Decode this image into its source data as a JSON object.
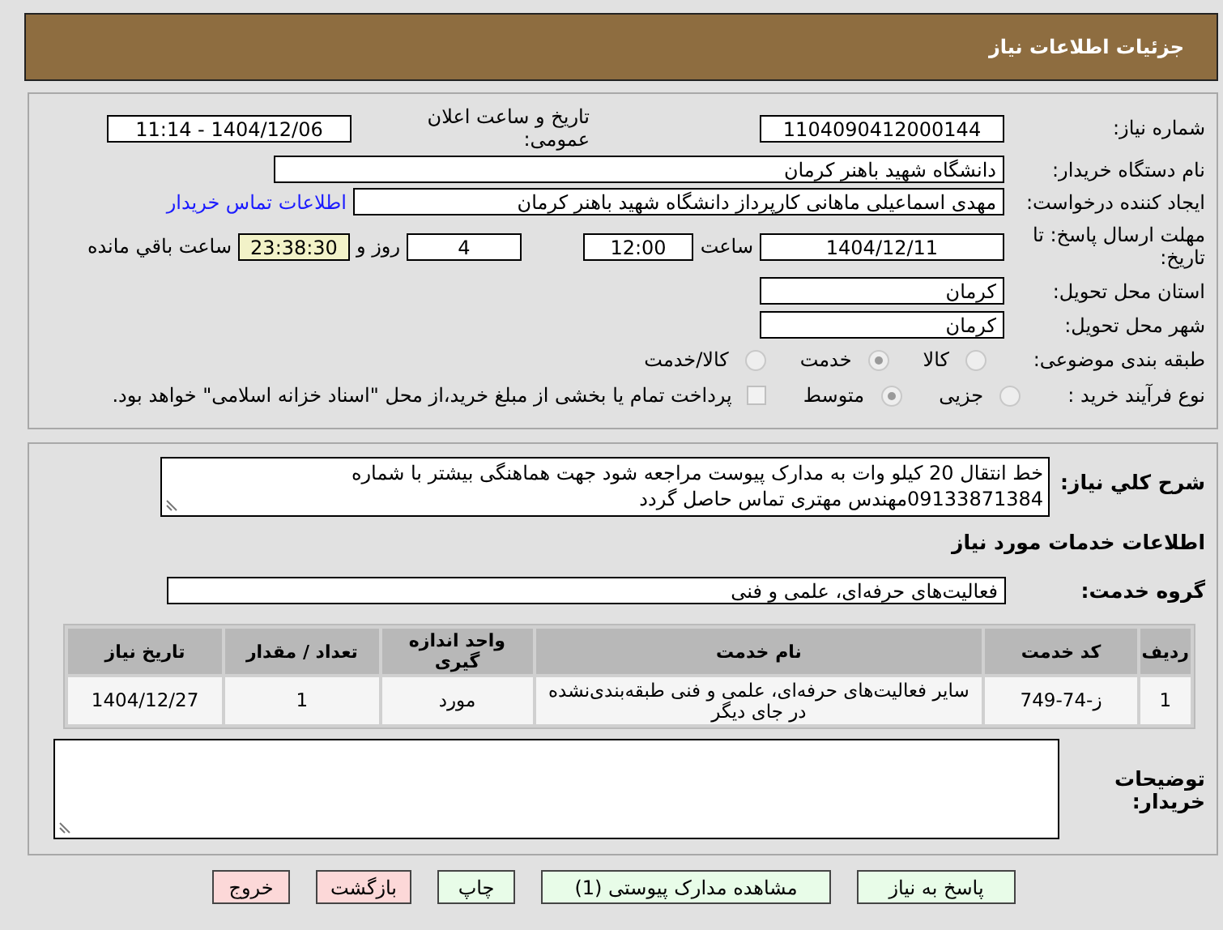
{
  "header": {
    "title": "جزئیات اطلاعات نیاز"
  },
  "need_number": {
    "label": "شماره نیاز:",
    "value": "1104090412000144"
  },
  "announce": {
    "label": "تاریخ و ساعت اعلان عمومی:",
    "value": "1404/12/06 - 11:14"
  },
  "buyer": {
    "label": "نام دستگاه خریدار:",
    "value": "دانشگاه شهید باهنر کرمان"
  },
  "creator": {
    "label": "ایجاد کننده درخواست:",
    "value": "مهدی اسماعیلی ماهانی  کارپرداز دانشگاه شهید باهنر کرمان",
    "link": "اطلاعات تماس خریدار"
  },
  "deadline": {
    "label": "مهلت ارسال پاسخ: تا تاریخ:",
    "date": "1404/12/11",
    "time_label": "ساعت",
    "time": "12:00",
    "days": "4",
    "days_label": "روز و",
    "remaining": "23:38:30",
    "remaining_label": "ساعت باقي مانده"
  },
  "province": {
    "label": "استان محل تحویل:",
    "value": "کرمان"
  },
  "city": {
    "label": "شهر محل تحویل:",
    "value": "کرمان"
  },
  "category": {
    "label": "طبقه بندی موضوعی:",
    "options": [
      {
        "label": "کالا",
        "selected": false
      },
      {
        "label": "خدمت",
        "selected": true
      },
      {
        "label": "کالا/خدمت",
        "selected": false
      }
    ]
  },
  "purchase_type": {
    "label": "نوع فرآیند خرید :",
    "options": [
      {
        "label": "جزیی",
        "selected": false
      },
      {
        "label": "متوسط",
        "selected": true
      }
    ],
    "payment": {
      "checked": false,
      "text": "پرداخت تمام یا بخشی از مبلغ خرید،از محل \"اسناد خزانه اسلامی\" خواهد بود."
    }
  },
  "description": {
    "label": "شرح کلي نياز:",
    "value": "خط انتقال 20 کیلو وات به مدارک پیوست مراجعه شود جهت هماهنگی بیشتر با شماره 09133871384مهندس مهتری تماس حاصل گردد"
  },
  "services_title": "اطلاعات خدمات مورد نیاز",
  "service_group": {
    "label": "گروه خدمت:",
    "value": "فعالیت‌های حرفه‌ای، علمی و فنی"
  },
  "table": {
    "columns": [
      "ردیف",
      "کد خدمت",
      "نام خدمت",
      "واحد اندازه گیری",
      "تعداد / مقدار",
      "تاریخ نیاز"
    ],
    "rows": [
      [
        "1",
        "ز-74-749",
        "سایر فعالیت‌های حرفه‌ای، علمی و فنی طبقه‌بندی‌نشده در جای دیگر",
        "مورد",
        "1",
        "1404/12/27"
      ]
    ]
  },
  "buyer_notes": {
    "label": "توضیحات خریدار:"
  },
  "buttons": [
    {
      "label": "پاسخ به نیاز",
      "color": "#e8fce8"
    },
    {
      "label": "مشاهده مدارک پیوستی (1)",
      "color": "#e8fce8"
    },
    {
      "label": "چاپ",
      "color": "#e8fce8"
    },
    {
      "label": "بازگشت",
      "color": "#fcd8d8"
    },
    {
      "label": "خروج",
      "color": "#fcd8d8"
    }
  ]
}
